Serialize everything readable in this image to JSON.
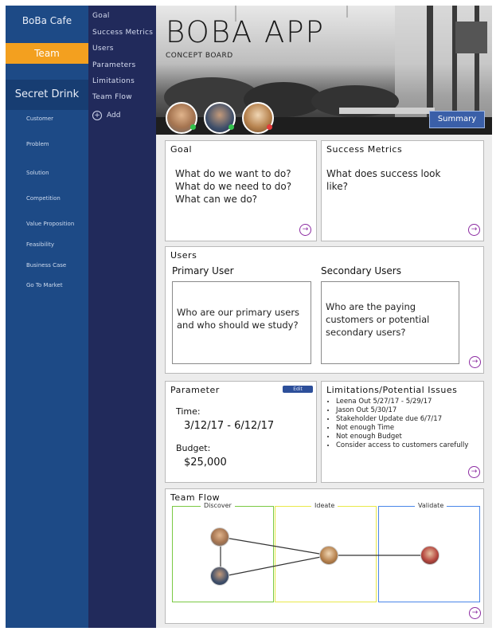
{
  "sidebar": {
    "app_name": "BoBa Cafe",
    "active_item": "Team",
    "section": "Secret Drink",
    "items": [
      "Customer",
      "Problem",
      "Solution",
      "Competition",
      "Value Proposition",
      "Feasibility",
      "Business Case",
      "Go To Market"
    ]
  },
  "subnav": {
    "items": [
      "Goal",
      "Success Metrics",
      "Users",
      "Parameters",
      "Limitations",
      "Team Flow"
    ],
    "add_label": "Add"
  },
  "header": {
    "title": "BOBA APP",
    "subtitle": "CONCEPT BOARD",
    "summary_label": "Summary"
  },
  "goal": {
    "title": "Goal",
    "lines": [
      "What do we want to do?",
      "What do we need to do?",
      "What can we do?"
    ]
  },
  "success": {
    "title": "Success Metrics",
    "lines": [
      "What does success look",
      "like?"
    ]
  },
  "users": {
    "title": "Users",
    "primary_label": "Primary User",
    "primary_lines": [
      "Who are our primary users",
      "and who should we study?"
    ],
    "secondary_label": "Secondary Users",
    "secondary_lines": [
      "Who are the paying",
      "customers or potential",
      "secondary users?"
    ]
  },
  "parameter": {
    "title": "Parameter",
    "edit_label": "Edit",
    "time_label": "Time:",
    "time_value": "3/12/17 - 6/12/17",
    "budget_label": "Budget:",
    "budget_value": "$25,000"
  },
  "limitations": {
    "title": "Limitations/Potential Issues",
    "items": [
      "Leena Out 5/27/17 - 5/29/17",
      "Jason Out 5/30/17",
      "Stakeholder Update due 6/7/17",
      "Not enough Time",
      "Not enough Budget",
      "Consider access to customers carefully"
    ]
  },
  "teamflow": {
    "title": "Team Flow",
    "phases": [
      "Discover",
      "Ideate",
      "Validate"
    ],
    "phase_colors": [
      "#7ac943",
      "#e8e84a",
      "#4a86e8"
    ]
  },
  "colors": {
    "sidebar": "#1d4a86",
    "subnav": "#212a5b",
    "accent_orange": "#f3a01f",
    "button_blue": "#3a5fa8",
    "arrow_purple": "#8b2aa1"
  }
}
